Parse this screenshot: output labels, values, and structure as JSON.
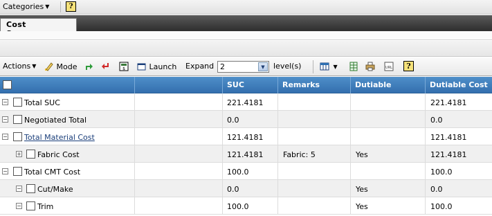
{
  "topbar": {
    "categories_label": "Categories",
    "help_label": "?"
  },
  "tab": {
    "label": "Cost Summary"
  },
  "toolbar": {
    "actions_label": "Actions",
    "mode_label": "Mode",
    "launch_label": "Launch",
    "expand_label": "Expand",
    "expand_value": "2",
    "levels_label": "level(s)",
    "help_label": "?"
  },
  "table": {
    "columns": [
      "SUC",
      "Remarks",
      "Dutiable",
      "Dutiable Cost"
    ],
    "rows": [
      {
        "name": "Total SUC",
        "suc": "221.4181",
        "remarks": "",
        "dutiable": "",
        "dutiable_cost": "221.4181",
        "expander": "−"
      },
      {
        "name": "Negotiated Total",
        "suc": "0.0",
        "remarks": "",
        "dutiable": "",
        "dutiable_cost": "0.0",
        "expander": "−"
      },
      {
        "name": "Total Material Cost",
        "suc": "121.4181",
        "remarks": "",
        "dutiable": "",
        "dutiable_cost": "121.4181",
        "expander": "−"
      },
      {
        "name": "Fabric Cost",
        "suc": "121.4181",
        "remarks": "Fabric: 5",
        "dutiable": "Yes",
        "dutiable_cost": "121.4181",
        "expander": "+"
      },
      {
        "name": "Total CMT Cost",
        "suc": "100.0",
        "remarks": "",
        "dutiable": "",
        "dutiable_cost": "100.0",
        "expander": "−"
      },
      {
        "name": "Cut/Make",
        "suc": "0.0",
        "remarks": "",
        "dutiable": "Yes",
        "dutiable_cost": "0.0",
        "expander": "−"
      },
      {
        "name": "Trim",
        "suc": "100.0",
        "remarks": "",
        "dutiable": "Yes",
        "dutiable_cost": "100.0",
        "expander": "−"
      }
    ]
  }
}
